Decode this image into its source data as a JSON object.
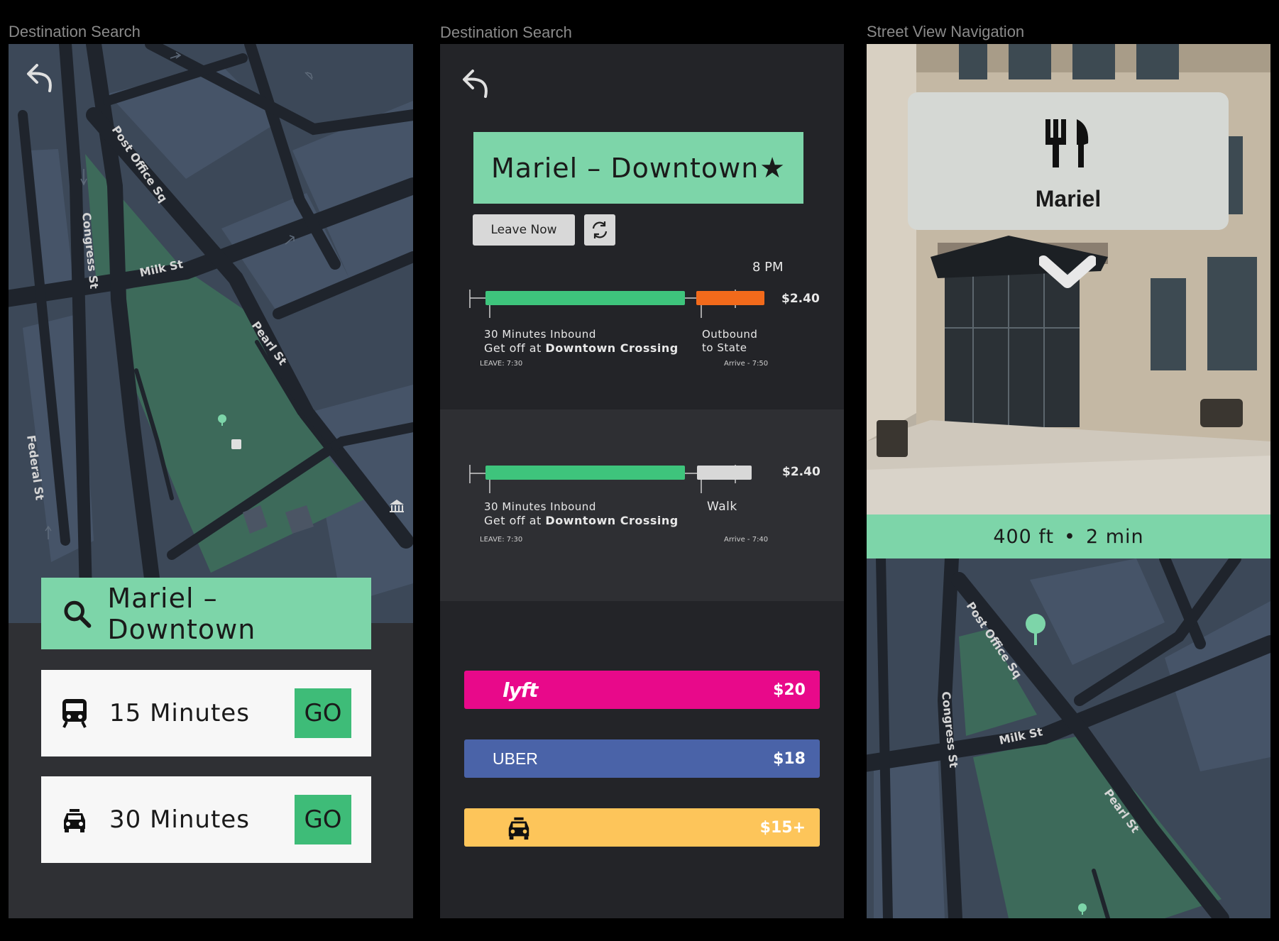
{
  "frames": [
    {
      "label": "Destination Search"
    },
    {
      "label": "Destination Search"
    },
    {
      "label": "Street View Navigation"
    }
  ],
  "map": {
    "streets": {
      "post_office_sq": "Post Office Sq",
      "congress_st": "Congress St",
      "milk_st": "Milk St",
      "pearl_st": "Pearl St",
      "federal_st": "Federal St"
    }
  },
  "search": {
    "destination": "Mariel – Downtown"
  },
  "options": [
    {
      "icon": "train-icon",
      "label": "15 Minutes",
      "go": "GO"
    },
    {
      "icon": "taxi-icon",
      "label": "30 Minutes",
      "go": "GO"
    }
  ],
  "trip": {
    "destination": "Mariel – Downtown",
    "leave_now": "Leave Now",
    "routes": [
      {
        "time_label": "8 PM",
        "price": "$2.40",
        "seg1_line1": "30 Minutes Inbound",
        "seg1_line2_prefix": "Get off at ",
        "seg1_line2_strong": "Downtown Crossing",
        "seg2_line1": "Outbound",
        "seg2_line2": "to State",
        "leave": "LEAVE: 7:30",
        "arrive": "Arrive - 7:50"
      },
      {
        "price": "$2.40",
        "seg1_line1": "30 Minutes Inbound",
        "seg1_line2_prefix": "Get off at ",
        "seg1_line2_strong": "Downtown Crossing",
        "seg2_line1": "Walk",
        "leave": "LEAVE: 7:30",
        "arrive": "Arrive - 7:40"
      }
    ],
    "rides": [
      {
        "brand": "lyft",
        "price": "$20",
        "color": "#e8098a"
      },
      {
        "brand": "UBER",
        "price": "$18",
        "color": "#4a63a8"
      },
      {
        "brand": "taxi-icon",
        "price": "$15+",
        "color": "#fdc55a"
      }
    ]
  },
  "street_view": {
    "place_name": "Mariel",
    "place_icon": "fork-knife-icon",
    "distance": "400 ft",
    "separator": "•",
    "time": "2 min"
  },
  "colors": {
    "accent_green": "#7dd5a9",
    "go_green": "#3ebc78",
    "transit_green": "#3ec47c",
    "outbound_orange": "#f26a1b",
    "lyft_pink": "#e8098a",
    "uber_blue": "#4a63a8",
    "taxi_yellow": "#fdc55a"
  }
}
